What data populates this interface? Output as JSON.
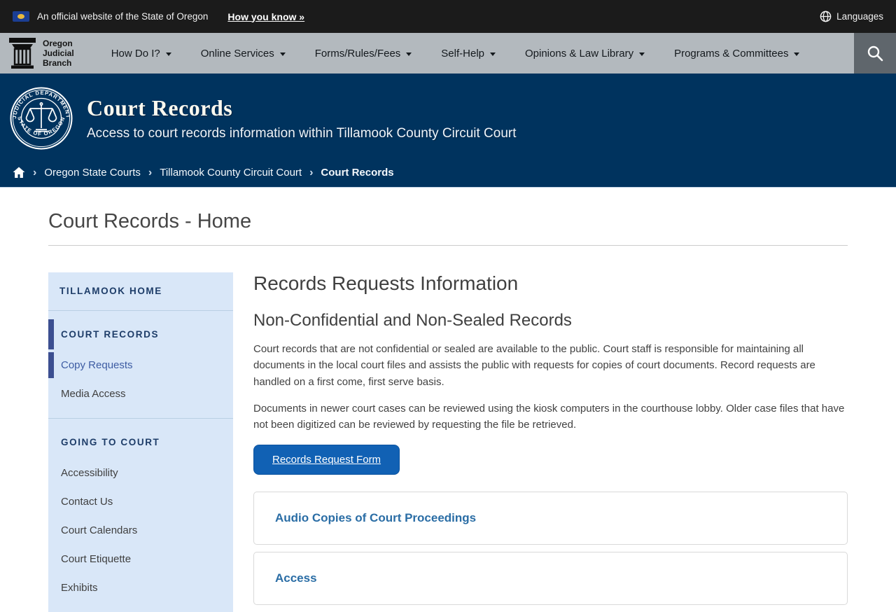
{
  "banner": {
    "text": "An official website of the State of Oregon",
    "how_link": "How you know »",
    "languages_label": "Languages"
  },
  "nav": {
    "logo": {
      "line1": "Oregon",
      "line2": "Judicial",
      "line3": "Branch"
    },
    "items": [
      {
        "label": "How Do I?"
      },
      {
        "label": "Online Services"
      },
      {
        "label": "Forms/Rules/Fees"
      },
      {
        "label": "Self-Help"
      },
      {
        "label": "Opinions & Law Library"
      },
      {
        "label": "Programs & Committees"
      }
    ]
  },
  "hero": {
    "title": "Court Records",
    "subtitle": "Access to court records information within Tillamook County Circuit Court",
    "seal": {
      "top_text": "JUDICIAL DEPARTMENT",
      "bottom_text": "STATE OF OREGON"
    }
  },
  "breadcrumb": {
    "separator": "›",
    "items": [
      {
        "label": "Oregon State Courts"
      },
      {
        "label": "Tillamook County Circuit Court"
      },
      {
        "label": "Court Records"
      }
    ]
  },
  "page": {
    "title": "Court Records - Home"
  },
  "sidebar": {
    "home_label": "TILLAMOOK HOME",
    "records_header": "COURT RECORDS",
    "records_items": [
      {
        "label": "Copy Requests"
      },
      {
        "label": "Media Access"
      }
    ],
    "court_header": "GOING TO COURT",
    "court_items": [
      {
        "label": "Accessibility"
      },
      {
        "label": "Contact Us"
      },
      {
        "label": "Court Calendars"
      },
      {
        "label": "Court Etiquette"
      },
      {
        "label": "Exhibits"
      }
    ]
  },
  "main": {
    "heading": "Records Requests Information",
    "subheading": "Non-Confidential and Non-Sealed Records",
    "para1": "Court records that are not confidential or sealed are available to the public. Court staff is responsible for maintaining all documents in the local court files and assists the public with requests for copies of court documents. Record requests are handled on a first come, first serve basis.",
    "para2": "Documents in newer court cases can be reviewed using the kiosk computers in the courthouse lobby. Older case files that have not been digitized can be reviewed by requesting the file be retrieved.",
    "button_label": "Records Request Form",
    "accordions": [
      {
        "title": "Audio Copies of Court Proceedings"
      },
      {
        "title": "Access"
      }
    ]
  },
  "colors": {
    "navy": "#00335e",
    "nav_gray": "#b3b9be",
    "search_gray": "#5f666c",
    "topbar_black": "#1b1b1b",
    "button_blue": "#1161b4",
    "accordion_link_blue": "#2a6da5",
    "sidebar_bg": "#d9e7f8",
    "sidebar_accent_bar": "#3c4f91",
    "sidebar_navy_text": "#1e3d69"
  }
}
